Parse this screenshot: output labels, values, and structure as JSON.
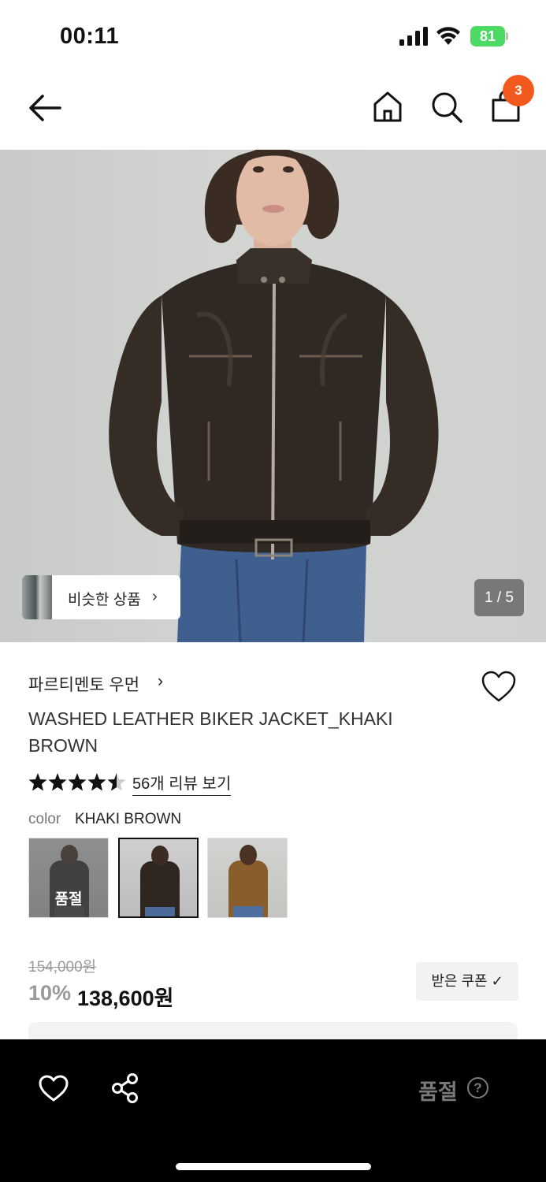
{
  "status_bar": {
    "time": "00:11",
    "battery": "81"
  },
  "nav": {
    "cart_count": "3"
  },
  "gallery": {
    "similar_label": "비슷한 상품",
    "counter": "1 / 5"
  },
  "product": {
    "brand": "파르티멘토 우먼",
    "title": "WASHED LEATHER BIKER JACKET_KHAKI BROWN",
    "rating": 4.5,
    "reviews_link": "56개 리뷰 보기",
    "color_label": "color",
    "color_value": "KHAKI BROWN",
    "swatches": [
      {
        "name": "black",
        "status": "품절"
      },
      {
        "name": "khaki brown",
        "status": ""
      },
      {
        "name": "camel",
        "status": ""
      }
    ],
    "original_price": "154,000원",
    "discount": "10%",
    "price": "138,600원",
    "coupon_button": "받은 쿠폰 ✓"
  },
  "bottom_bar": {
    "status_label": "품절",
    "help_icon": "?"
  },
  "colors": {
    "badge": "#f25a1d",
    "battery": "#4cd964",
    "bottom_bar": "#000000"
  }
}
